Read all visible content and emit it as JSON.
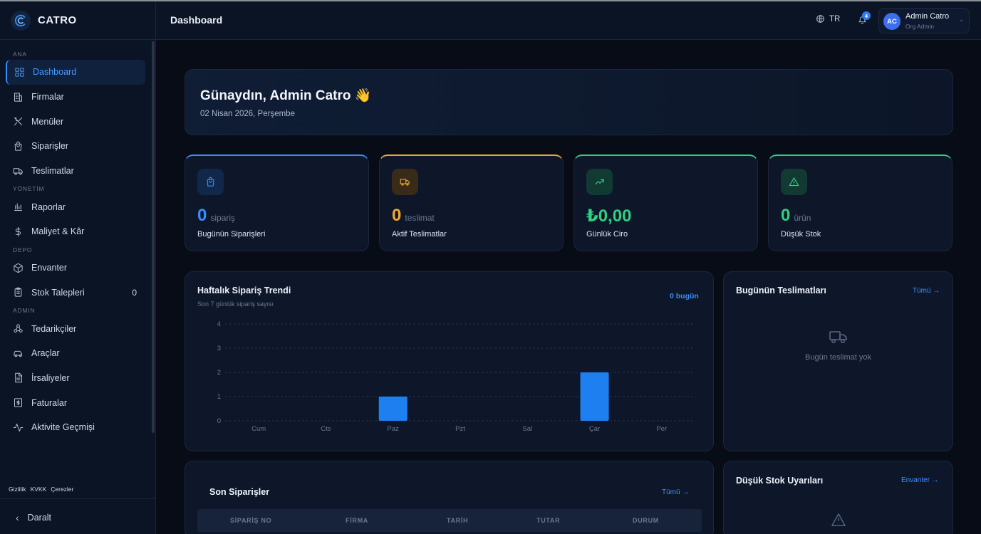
{
  "brand": {
    "name": "CATRO"
  },
  "sidebar": {
    "sections": [
      {
        "title": "ANA",
        "items": [
          {
            "label": "Dashboard",
            "icon": "grid-icon",
            "active": true
          },
          {
            "label": "Firmalar",
            "icon": "building-icon"
          },
          {
            "label": "Menüler",
            "icon": "utensils-icon"
          },
          {
            "label": "Siparişler",
            "icon": "shopping-bag-icon"
          },
          {
            "label": "Teslimatlar",
            "icon": "truck-icon"
          }
        ]
      },
      {
        "title": "YÖNETİM",
        "items": [
          {
            "label": "Raporlar",
            "icon": "bar-chart-icon"
          },
          {
            "label": "Maliyet & Kâr",
            "icon": "dollar-icon"
          }
        ]
      },
      {
        "title": "DEPO",
        "items": [
          {
            "label": "Envanter",
            "icon": "package-icon"
          },
          {
            "label": "Stok Talepleri",
            "icon": "clipboard-icon",
            "count": "0"
          }
        ]
      },
      {
        "title": "ADMIN",
        "items": [
          {
            "label": "Tedarikçiler",
            "icon": "network-icon"
          },
          {
            "label": "Araçlar",
            "icon": "car-icon"
          },
          {
            "label": "İrsaliyeler",
            "icon": "file-icon"
          },
          {
            "label": "Faturalar",
            "icon": "receipt-icon"
          },
          {
            "label": "Aktivite Geçmişi",
            "icon": "activity-icon"
          }
        ]
      }
    ],
    "legal": [
      "Gizlilik",
      "KVKK",
      "Çerezler"
    ],
    "collapse_label": "Daralt"
  },
  "header": {
    "title": "Dashboard",
    "lang": "TR",
    "notifications": "4",
    "user": {
      "initials": "AC",
      "name": "Admin Catro",
      "role": "Org Admin"
    }
  },
  "welcome": {
    "greeting": "Günaydın, Admin Catro 👋",
    "date": "02 Nisan 2026, Perşembe"
  },
  "stats": [
    {
      "value": "0",
      "unit": "sipariş",
      "label": "Bugünün Siparişleri",
      "color": "#3b8cff",
      "icon": "shopping-bag-icon"
    },
    {
      "value": "0",
      "unit": "teslimat",
      "label": "Aktif Teslimatlar",
      "color": "#f0a830",
      "icon": "truck-icon"
    },
    {
      "value": "₺0,00",
      "unit": "",
      "label": "Günlük Ciro",
      "color": "#2fd07f",
      "icon": "trending-up-icon"
    },
    {
      "value": "0",
      "unit": "ürün",
      "label": "Düşük Stok",
      "color": "#2fd07f",
      "icon": "alert-triangle-icon"
    }
  ],
  "trend": {
    "title": "Haftalık Sipariş Trendi",
    "subtitle": "Son 7 günlük sipariş sayısı",
    "badge": "0 bugün"
  },
  "chart_data": {
    "type": "bar",
    "categories": [
      "Cum",
      "Cts",
      "Paz",
      "Pzt",
      "Sal",
      "Çar",
      "Per"
    ],
    "values": [
      0,
      0,
      1,
      0,
      0,
      2,
      0
    ],
    "title": "Haftalık Sipariş Trendi",
    "ylim": [
      0,
      4
    ],
    "yticks": [
      0,
      1,
      2,
      3,
      4
    ],
    "grid": true,
    "bar_color": "#1e7ff0"
  },
  "deliveries": {
    "title": "Bugünün Teslimatları",
    "link": "Tümü →",
    "empty": "Bugün teslimat yok"
  },
  "orders": {
    "title": "Son Siparişler",
    "link": "Tümü →",
    "columns": [
      "SİPARİŞ NO",
      "FİRMA",
      "TARİH",
      "TUTAR",
      "DURUM"
    ]
  },
  "low_stock": {
    "title": "Düşük Stok Uyarıları",
    "link": "Envanter →"
  }
}
